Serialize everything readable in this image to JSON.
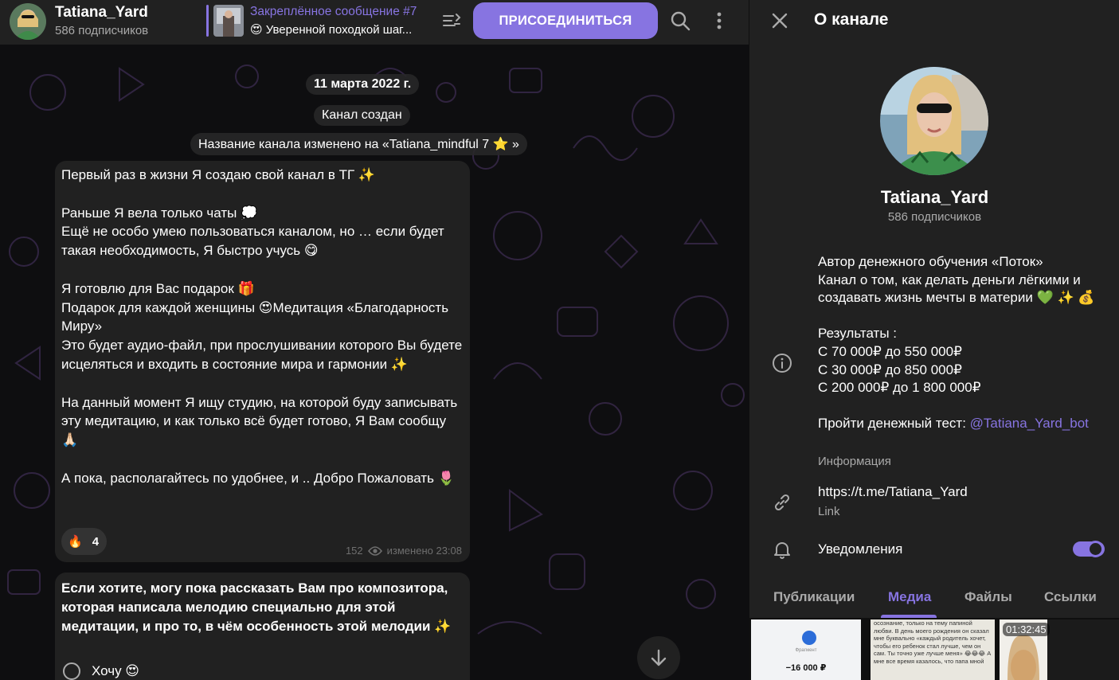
{
  "chat": {
    "header": {
      "title": "Tatiana_Yard",
      "subtitle": "586 подписчиков",
      "pinned_title": "Закреплённое сообщение #7",
      "pinned_text": "😍 Уверенной походкой шаг...",
      "join_label": "ПРИСОЕДИНИТЬСЯ"
    },
    "system": {
      "date": "11 марта 2022 г.",
      "created": "Канал создан",
      "renamed": "Название канала изменено на «Tatiana_mindful 7 ⭐ »"
    },
    "messages": [
      {
        "text": "Первый раз в жизни Я создаю свой канал в ТГ ✨\n\nРаньше Я вела только чаты 💭\nЕщё не особо умею пользоваться каналом, но … если будет такая необходимость, Я быстро учусь 😋\n\nЯ готовлю для Вас подарок 🎁\nПодарок для каждой женщины 😍Медитация «Благодарность Миру»\nЭто будет аудио-файл, при прослушивании которого Вы будете исцеляться и входить в состояние мира и гармонии ✨\n\nНа данный момент Я ищу студию, на которой буду записывать эту медитацию, и как только всё будет готово, Я Вам сообщу 🙏🏻\n\nА пока, располагайтесь по удобнее, и .. Добро Пожаловать 🌷",
        "reaction_emoji": "🔥",
        "reaction_count": "4",
        "views": "152",
        "edited": "изменено 23:08"
      },
      {
        "text": "Если хотите, могу пока рассказать Вам про композитора, которая написала мелодию специально для этой медитации, и про то, в чём особенность этой мелодии ✨",
        "poll_option": "Хочу 😍"
      }
    ]
  },
  "panel": {
    "title": "О канале",
    "name": "Tatiana_Yard",
    "subscribers": "586 подписчиков",
    "description_main": "Автор денежного обучения «Поток»\nКанал о том, как делать деньги лёгкими и создавать жизнь мечты в материи 💚 ✨ 💰\n\nРезультаты :\nС 70 000₽ до 550 000₽\nС 30 000₽ до 850 000₽\nС 200 000₽ до 1 800 000₽\n\nПройти денежный тест: ",
    "description_link": "@Tatiana_Yard_bot",
    "description_label": "Информация",
    "link": "https://t.me/Tatiana_Yard",
    "link_label": "Link",
    "notifications_label": "Уведомления",
    "notifications_on": true,
    "tabs": [
      "Публикации",
      "Медиа",
      "Файлы",
      "Ссылки"
    ],
    "active_tab": "Медиа",
    "media": [
      {
        "text_top": "Фрагмент",
        "amount": "−16 000 ₽"
      },
      {
        "text": "осознание, только на тему папиной любви. В день моего рождения он сказал мне буквально «каждый родитель хочет, чтобы его ребенок стал лучше, чем он сам. Ты точно уже лучше меня» 😂😂😂 А мне все время казалось, что папа мной"
      },
      {
        "duration": "01:32:45"
      }
    ]
  },
  "colors": {
    "accent": "#8774e1",
    "bubble": "#212121",
    "panel": "#212121",
    "muted": "#aaaaaa"
  }
}
